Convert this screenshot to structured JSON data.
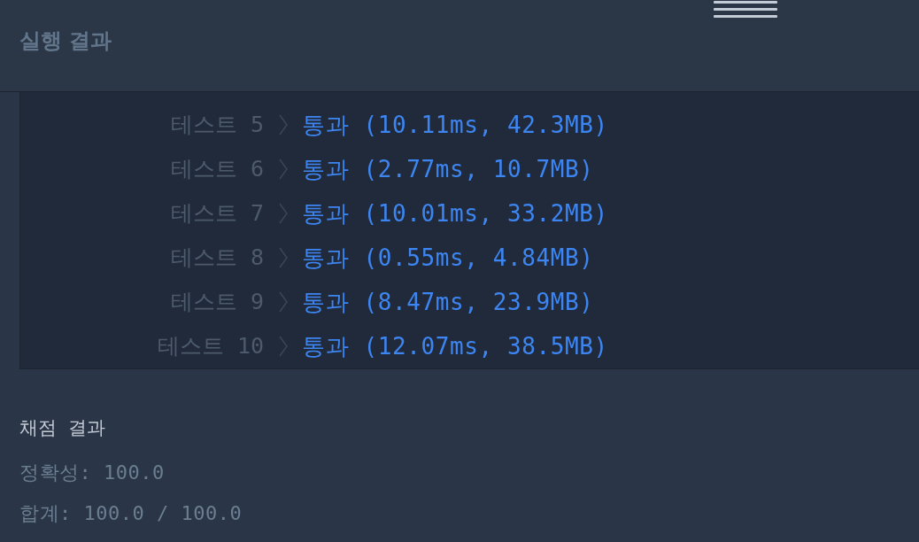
{
  "header": {
    "title": "실행 결과"
  },
  "tests": [
    {
      "label": "테스트 5",
      "result": "통과 (10.11ms, 42.3MB)"
    },
    {
      "label": "테스트 6",
      "result": "통과 (2.77ms, 10.7MB)"
    },
    {
      "label": "테스트 7",
      "result": "통과 (10.01ms, 33.2MB)"
    },
    {
      "label": "테스트 8",
      "result": "통과 (0.55ms, 4.84MB)"
    },
    {
      "label": "테스트 9",
      "result": "통과 (8.47ms, 23.9MB)"
    },
    {
      "label": "테스트 10",
      "result": "통과 (12.07ms, 38.5MB)"
    }
  ],
  "grading": {
    "title": "채점 결과",
    "lines": [
      "정확성: 100.0",
      "합계: 100.0 / 100.0"
    ]
  }
}
